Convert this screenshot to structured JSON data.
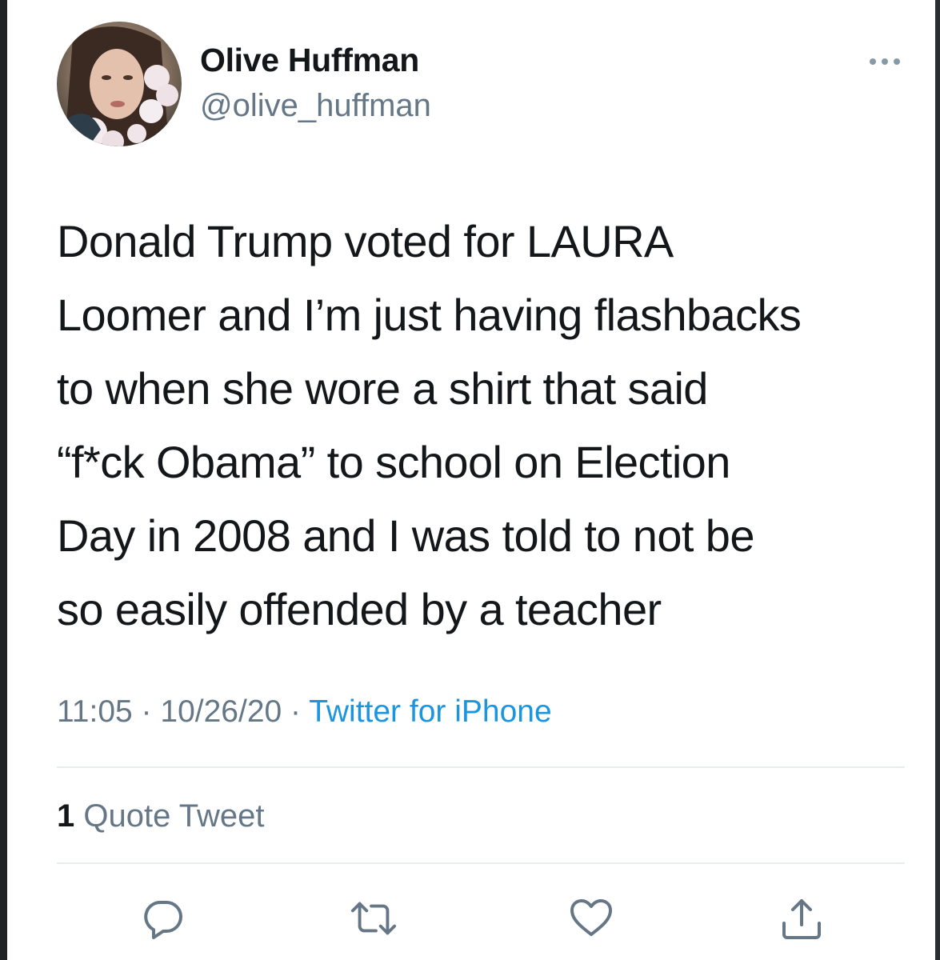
{
  "tweet": {
    "author": {
      "name": "Olive Huffman",
      "handle": "@olive_huffman",
      "avatar": "profile-photo"
    },
    "more_icon": "more-dots-icon",
    "text": "Donald Trump voted for LAURA\nLoomer and I’m just having flashbacks\nto when she wore a shirt that said\n“f*ck Obama” to school on Election\nDay in 2008 and I was told to not be\nso easily offended by a teacher",
    "time": "11:05",
    "date": "10/26/20",
    "separator": "·",
    "source": "Twitter for iPhone",
    "quote_tweets": {
      "count": "1",
      "label": "Quote Tweet"
    },
    "actions": [
      {
        "name": "reply",
        "icon": "reply-icon"
      },
      {
        "name": "retweet",
        "icon": "retweet-icon"
      },
      {
        "name": "like",
        "icon": "heart-icon"
      },
      {
        "name": "share",
        "icon": "share-icon"
      }
    ]
  },
  "colors": {
    "text": "#14171a",
    "secondary": "#657786",
    "link": "#1b95e0",
    "divider": "#e6ecf0"
  }
}
